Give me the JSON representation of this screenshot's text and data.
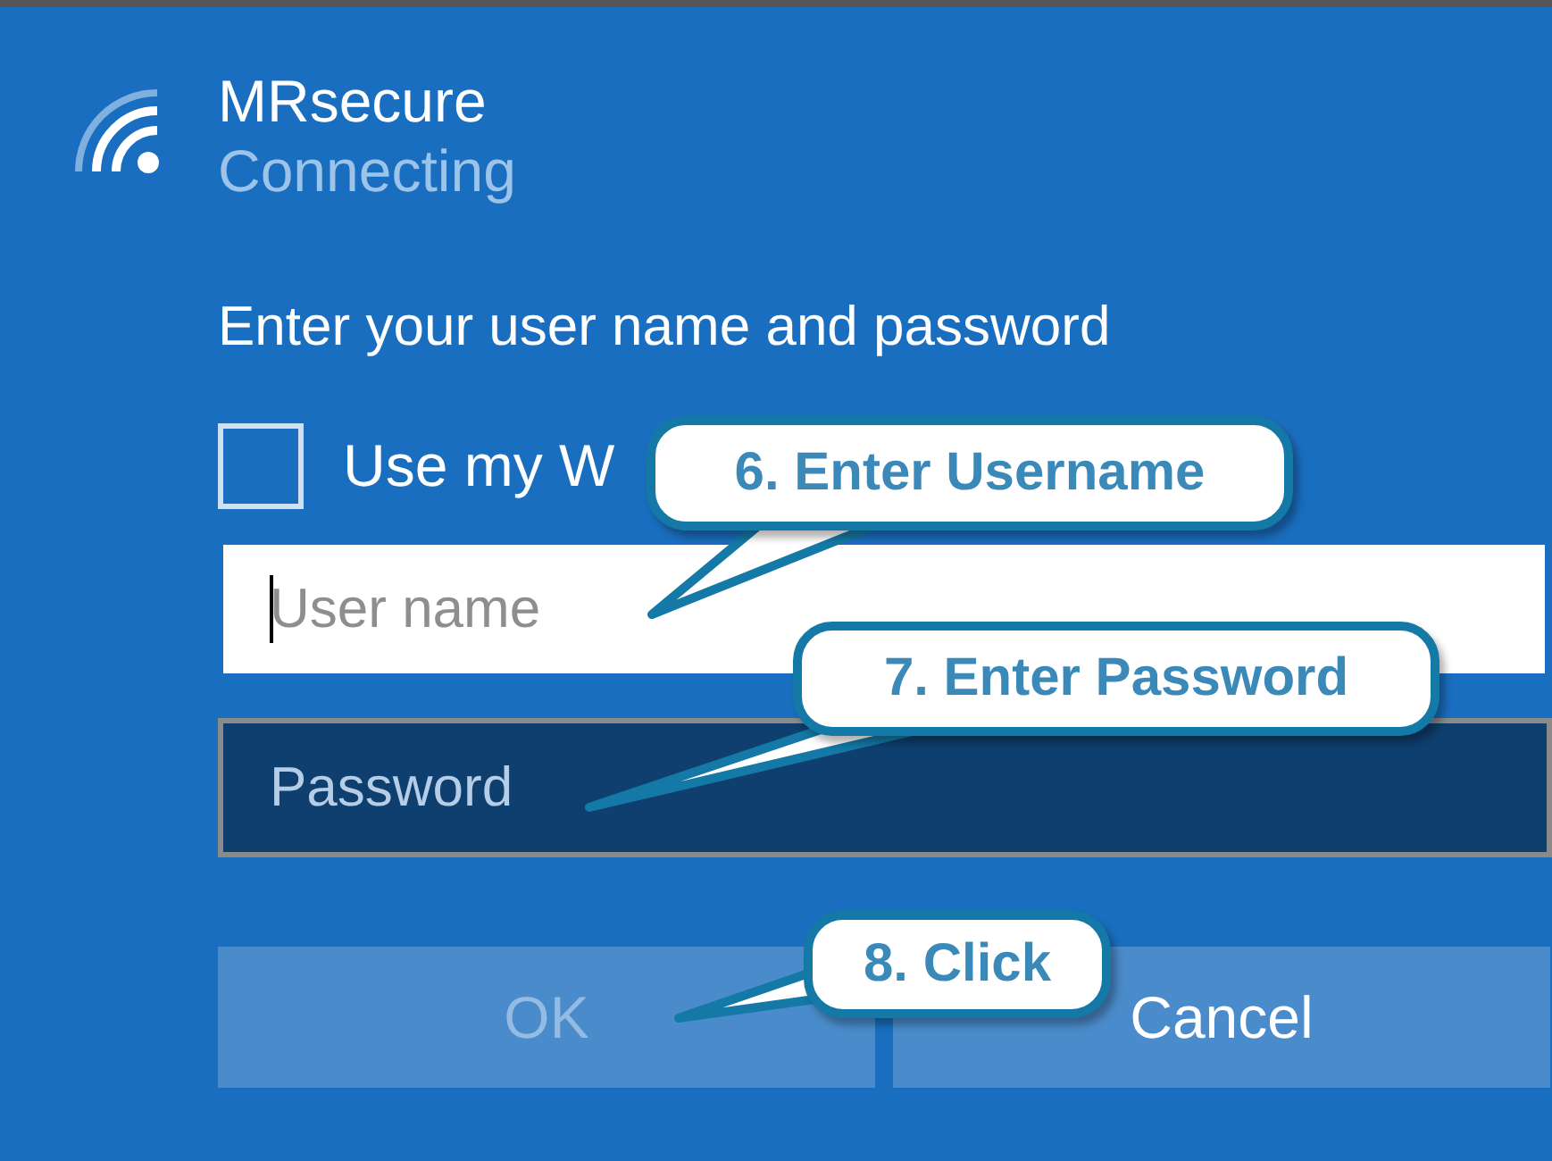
{
  "network": {
    "name": "MRsecure",
    "status": "Connecting"
  },
  "prompt": "Enter your user name and password",
  "option": {
    "label": "Use my W",
    "checked": false
  },
  "fields": [
    {
      "placeholder": "User name",
      "focused": true
    },
    {
      "placeholder": "Password",
      "focused": false
    }
  ],
  "buttons": [
    {
      "label": "OK",
      "disabled": true
    },
    {
      "label": "Cancel",
      "disabled": false
    }
  ],
  "callouts": [
    {
      "text": "6. Enter Username"
    },
    {
      "text": "7. Enter Password"
    },
    {
      "text": "8. Click"
    }
  ]
}
